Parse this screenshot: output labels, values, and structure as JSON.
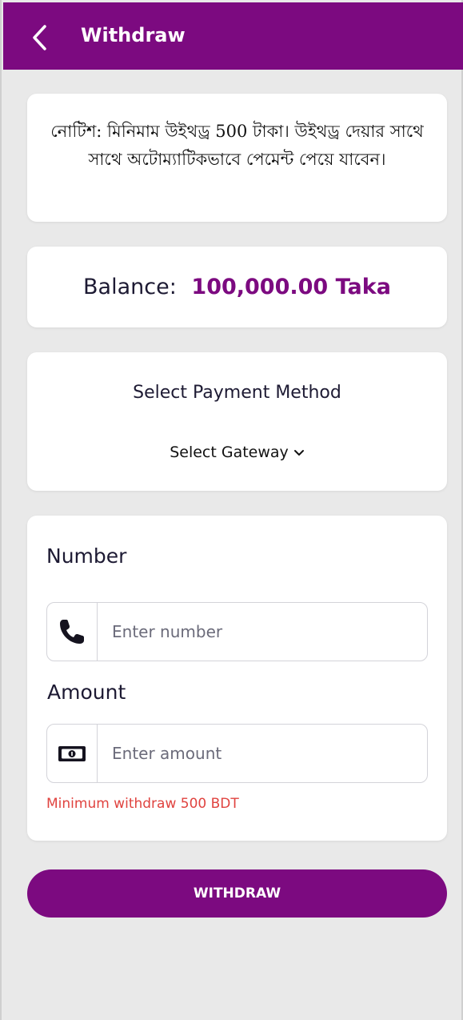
{
  "header": {
    "title": "Withdraw",
    "background_color": "#7c0a80"
  },
  "notice": {
    "text": "নোটিশ: মিনিমাম উইথড্র 500 টাকা। উইথড্র দেয়ার সাথে সাথে অটোম্যাটিকভাবে পেমেন্ট পেয়ে যাবেন।"
  },
  "balance": {
    "label": "Balance:",
    "value": "100,000.00 Taka",
    "value_color": "#7c0a80"
  },
  "payment": {
    "title": "Select Payment Method",
    "gateway_label": "Select Gateway"
  },
  "form": {
    "number_label": "Number",
    "number_placeholder": "Enter number",
    "amount_label": "Amount",
    "amount_placeholder": "Enter amount",
    "min_note": "Minimum withdraw 500 BDT",
    "min_note_color": "#e0433f"
  },
  "actions": {
    "withdraw_label": "WITHDRAW"
  },
  "icons": [
    "back-arrow-icon",
    "phone-icon",
    "cash-icon",
    "chevron-down-icon"
  ]
}
